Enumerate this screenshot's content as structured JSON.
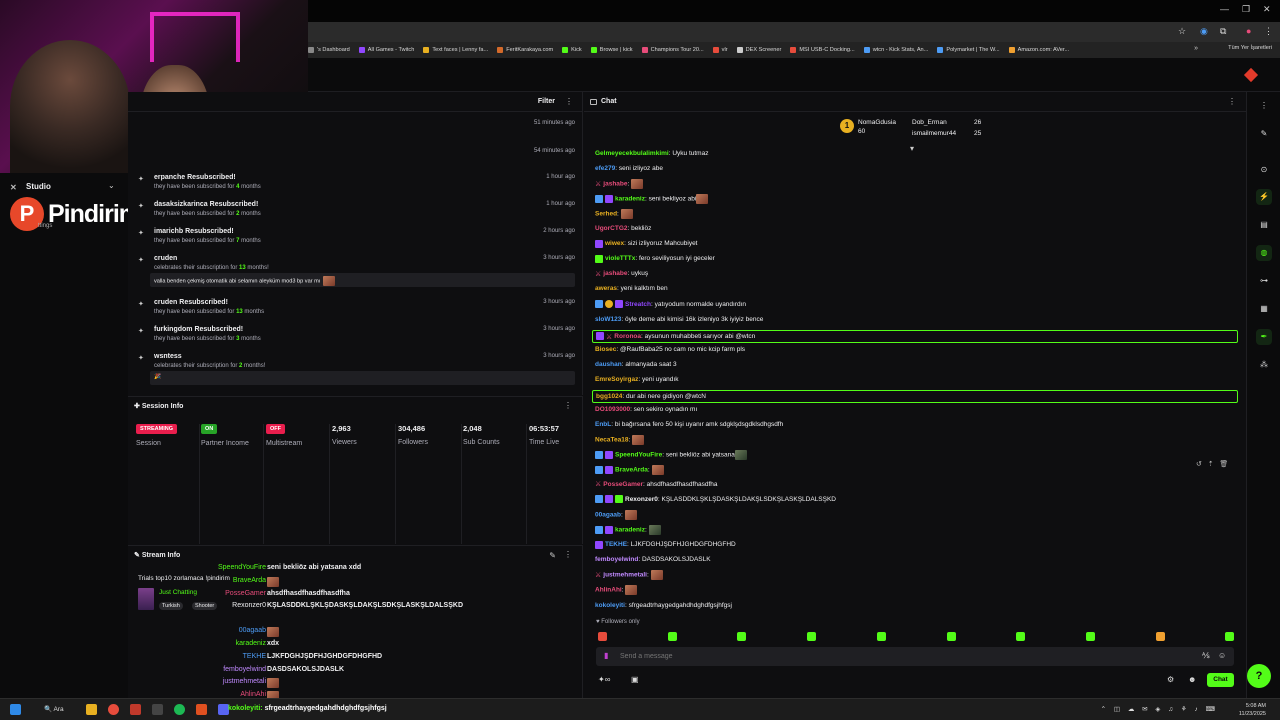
{
  "colors": {
    "accent": "#53fc18",
    "live_red": "#e91e4d",
    "bg": "#0e0e10",
    "panel": "#1f1f23"
  },
  "bookmarks": [
    {
      "label": "'s Dashboard",
      "icon": "dashboard-icon"
    },
    {
      "label": "All Games - Twitch",
      "icon": "twitch-icon"
    },
    {
      "label": "Text faces | Lenny fa...",
      "icon": "face-icon"
    },
    {
      "label": "FeritKarakaya.com",
      "icon": "site-icon"
    },
    {
      "label": "Kick",
      "icon": "kick-icon"
    },
    {
      "label": "Browse | kick",
      "icon": "kick-icon"
    },
    {
      "label": "Champions Tour 20...",
      "icon": "valorant-icon"
    },
    {
      "label": "vlr",
      "icon": "vlr-icon"
    },
    {
      "label": "DEX Screener",
      "icon": "dex-icon"
    },
    {
      "label": "MSI USB-C Docking...",
      "icon": "msi-icon"
    },
    {
      "label": "wtcn - Kick Stats, An...",
      "icon": "stats-icon"
    },
    {
      "label": "Polymarket | The W...",
      "icon": "polymarket-icon"
    },
    {
      "label": "Amazon.com: AVer...",
      "icon": "amazon-icon"
    }
  ],
  "bookmarks_all": "Tüm Yer İşaretleri",
  "sidebar": {
    "studio_label": "Studio",
    "brand_letter": "P",
    "brand_name": "Pindirim",
    "settings_label": "ttings"
  },
  "activity": {
    "filter_label": "Filter",
    "items": [
      {
        "title": "",
        "sub": "",
        "time": "51 minutes ago"
      },
      {
        "title": "",
        "sub": "",
        "time": "54 minutes ago"
      },
      {
        "title": "erpanche Resubscribed!",
        "sub_pre": "they have been subscribed for ",
        "sub_num": "4",
        "sub_post": " months",
        "time": "1 hour ago"
      },
      {
        "title": "dasaksizkarinca Resubscribed!",
        "sub_pre": "they have been subscribed for ",
        "sub_num": "2",
        "sub_post": " months",
        "time": "1 hour ago"
      },
      {
        "title": "imarichb Resubscribed!",
        "sub_pre": "they have been subscribed for ",
        "sub_num": "7",
        "sub_post": " months",
        "time": "2 hours ago"
      },
      {
        "title": "cruden",
        "sub_pre": "celebrates their subscription for ",
        "sub_num": "13",
        "sub_post": " months!",
        "time": "3 hours ago",
        "msg": "valla benden çekmiş otomatik abi selamın aleyküm mod3 bp var mı"
      },
      {
        "title": "cruden Resubscribed!",
        "sub_pre": "they have been subscribed for ",
        "sub_num": "13",
        "sub_post": " months",
        "time": "3 hours ago"
      },
      {
        "title": "furkingdom Resubscribed!",
        "sub_pre": "they have been subscribed for ",
        "sub_num": "3",
        "sub_post": " months",
        "time": "3 hours ago"
      },
      {
        "title": "wsntess",
        "sub_pre": "celebrates their subscription for ",
        "sub_num": "2",
        "sub_post": " months!",
        "time": "3 hours ago",
        "msg": "🎉"
      }
    ]
  },
  "session": {
    "header": "Session Info",
    "streaming_pill": "STREAMING",
    "session_label": "Session",
    "on_pill": "ON",
    "partner_label": "Partner Income",
    "off_pill": "OFF",
    "multistream_label": "Multistream",
    "viewers": "2,963",
    "viewers_label": "Viewers",
    "followers": "304,486",
    "followers_label": "Followers",
    "subs": "2,048",
    "subs_label": "Sub Counts",
    "time": "06:53:57",
    "time_label": "Time Live"
  },
  "stream_info": {
    "header": "Stream Info",
    "title": "Trials top10 zorlamaca !pindirim",
    "category": "Just Chatting",
    "tags": [
      "Turkish",
      "Shooter"
    ],
    "chat": [
      {
        "user": "SpeendYouFire",
        "color": "#53fc18",
        "text": "seni bekliöz abi yatsana xdd"
      },
      {
        "user": "BraveArda",
        "color": "#53fc18",
        "text": "",
        "emote": true
      },
      {
        "user": "PosseGamer",
        "color": "#e74c7a",
        "text": "ahsdfhasdfhasdfhasdfha"
      },
      {
        "user": "Rexonzer0",
        "color": "#efeff1",
        "text": "KŞLASDDKLŞKLŞDASKŞLDAKŞLSDKŞLASKŞLDALSŞKD"
      },
      {
        "user": "00agaab",
        "color": "#4d9cf5",
        "text": "",
        "emote": true
      },
      {
        "user": "karadeniz",
        "color": "#53fc18",
        "text": "xdx"
      },
      {
        "user": "TEKHE",
        "color": "#4d9cf5",
        "text": "LJKFDGHJŞDFHJGHDGFDHGFHD"
      },
      {
        "user": "femboyelwind",
        "color": "#c08aff",
        "text": "DASDSAKOLSJDASLK"
      },
      {
        "user": "justmehmetali",
        "color": "#c08aff",
        "text": "",
        "emote": true
      },
      {
        "user": "AhlinAhi",
        "color": "#e74c7a",
        "text": "",
        "emote": true
      }
    ]
  },
  "chat": {
    "title": "Chat",
    "leaderboard": [
      {
        "name": "NomaGdusia",
        "count": "60",
        "color": "#e8b021"
      },
      {
        "name": "Dob_Erman",
        "count": "26",
        "color": "#efeff1"
      },
      {
        "name": "ismailmemur44",
        "count": "25",
        "color": "#e8b021"
      }
    ],
    "messages": [
      {
        "user": "Gelmeyecekbulalimkimi",
        "color": "#53fc18",
        "text": ": Uyku tutmaz",
        "badges": []
      },
      {
        "user": "efe279",
        "color": "#4d9cf5",
        "text": ": seni izliyoz abe",
        "badges": []
      },
      {
        "user": "jashabe",
        "color": "#e74c7a",
        "text": ": ",
        "badges": [
          "sword"
        ],
        "emote": true
      },
      {
        "user": "karadeniz",
        "color": "#53fc18",
        "text": ": seni bekliyoz abi",
        "badges": [
          "sub",
          "og"
        ],
        "emote": true
      },
      {
        "user": "Serhed",
        "color": "#e8b021",
        "text": ": ",
        "badges": [],
        "emote": true
      },
      {
        "user": "UgorCTG2",
        "color": "#e74c7a",
        "text": ": bekliöz",
        "badges": []
      },
      {
        "user": "wiwex",
        "color": "#e8b021",
        "text": ": sizi izliyoruz Mahcubiyet",
        "badges": [
          "og"
        ]
      },
      {
        "user": "violeTTTx",
        "color": "#53fc18",
        "text": ": fero seviliyosun iyi geceler",
        "badges": [
          "mod"
        ]
      },
      {
        "user": "jashabe",
        "color": "#e74c7a",
        "text": ": uykuş",
        "badges": [
          "sword"
        ]
      },
      {
        "user": "aweras",
        "color": "#e8b021",
        "text": ": yeni kalktım ben",
        "badges": []
      },
      {
        "user": "Streatch",
        "color": "#9147ff",
        "text": ": yatıyodum normalde uyandırdın",
        "badges": [
          "sub",
          "vip",
          "og"
        ]
      },
      {
        "user": "sloW123",
        "color": "#4d9cf5",
        "text": ": öyle deme abi kimisi 16k izleniyo 3k iyiyiz bence",
        "badges": []
      },
      {
        "user": "Roronoa",
        "color": "#e74c7a",
        "text": ": aysunun muhabbeti sarıyor abi @wtcn",
        "badges": [
          "og",
          "sword"
        ],
        "highlight": true
      },
      {
        "user": "Biosec",
        "color": "#e8b021",
        "text": ": @RaufBaba25 no cam no mic kcip farm pls",
        "badges": []
      },
      {
        "user": "daushan",
        "color": "#4d9cf5",
        "text": ": almanyada saat 3",
        "badges": []
      },
      {
        "user": "EmreSoyirgaz",
        "color": "#e8b021",
        "text": ": yeni uyandık",
        "badges": []
      },
      {
        "user": "bgg1024",
        "color": "#e8b021",
        "text": ": dur abi nere gidiyon @wtcN",
        "badges": [],
        "highlight": true
      },
      {
        "user": "DO1093000",
        "color": "#e74c7a",
        "text": ": sen sekiro oynadın mı",
        "badges": []
      },
      {
        "user": "EnbL",
        "color": "#4d9cf5",
        "text": ": bi bağırsana fero 50 kişi uyanır amk sdgklşdsgdklsdhgsdfh",
        "badges": []
      },
      {
        "user": "NecaTea18",
        "color": "#e8b021",
        "text": ": ",
        "badges": [],
        "emote": true
      },
      {
        "user": "SpeendYouFire",
        "color": "#53fc18",
        "text": ": seni bekliöz abi yatsana",
        "badges": [
          "sub",
          "og"
        ],
        "emote": true
      },
      {
        "user": "BraveArda",
        "color": "#53fc18",
        "text": ": ",
        "badges": [
          "sub",
          "og"
        ],
        "emote": true
      },
      {
        "user": "PosseGamer",
        "color": "#e74c7a",
        "text": ": ahsdfhasdfhasdfhasdfha",
        "badges": [
          "sword"
        ]
      },
      {
        "user": "Rexonzer0",
        "color": "#efeff1",
        "text": ": KŞLASDDKLŞKLŞDASKŞLDAKŞLSDKŞLASKŞLDALSŞKD",
        "badges": [
          "sub",
          "og",
          "mod"
        ]
      },
      {
        "user": "00agaab",
        "color": "#4d9cf5",
        "text": ": ",
        "badges": [],
        "emote": true
      },
      {
        "user": "karadeniz",
        "color": "#53fc18",
        "text": ": ",
        "badges": [
          "sub",
          "og"
        ],
        "emote": true
      },
      {
        "user": "TEKHE",
        "color": "#4d9cf5",
        "text": ": LJKFDGHJŞDFHJGHDGFDHGFHD",
        "badges": [
          "og"
        ]
      },
      {
        "user": "femboyelwind",
        "color": "#c08aff",
        "text": ": DASDSAKOLSJDASLK",
        "badges": []
      },
      {
        "user": "justmehmetali",
        "color": "#c08aff",
        "text": ": ",
        "badges": [
          "sword"
        ],
        "emote": true
      },
      {
        "user": "AhlinAhi",
        "color": "#e74c7a",
        "text": ": ",
        "badges": [],
        "emote": true
      },
      {
        "user": "kokoleyiti",
        "color": "#4d9cf5",
        "text": ": sfrgeadtrhaygedgahdhdghdfgsjhfgsj",
        "badges": []
      }
    ],
    "followers_only": "Followers only",
    "input_placeholder": "Send a message",
    "send_label": "Chat"
  },
  "taskbar": {
    "search_label": "Ara",
    "ticker_user": "kokoleyiti:",
    "ticker_text": "sfrgeadtrhaygedgahdhdghdfgsjhfgsj",
    "time": "5:08 AM",
    "date": "11/23/2025"
  }
}
